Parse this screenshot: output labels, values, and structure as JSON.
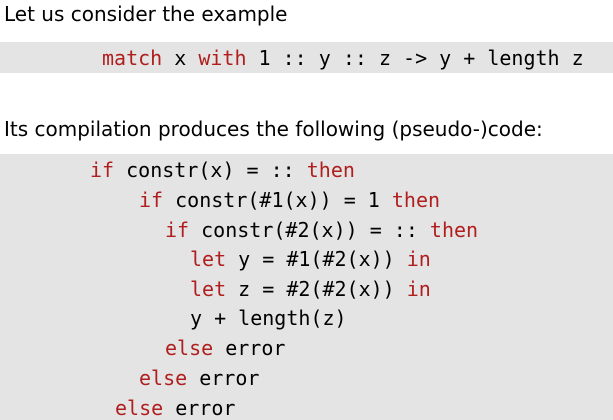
{
  "intro": "Let us consider the example",
  "example_code": {
    "kw_match": "match",
    "seg1": " x ",
    "kw_with": "with",
    "seg2": " 1 :: y :: z -> y + length z"
  },
  "compilation_text": "Its compilation produces the following (pseudo-)code:",
  "compiled_code": {
    "line1": {
      "kw_if": "if",
      "body": " constr(x) = :: ",
      "kw_then": "then"
    },
    "line2": {
      "kw_if": "if",
      "body": " constr(#1(x)) = 1 ",
      "kw_then": "then"
    },
    "line3": {
      "kw_if": "if",
      "body": " constr(#2(x)) = :: ",
      "kw_then": "then"
    },
    "line4": {
      "kw_let": "let",
      "body": " y = #1(#2(x)) ",
      "kw_in": "in"
    },
    "line5": {
      "kw_let": "let",
      "body": " z = #2(#2(x)) ",
      "kw_in": "in"
    },
    "line6": {
      "body": "y + length(z)"
    },
    "line7": {
      "kw_else": "else",
      "body": " error"
    },
    "line8": {
      "kw_else": "else",
      "body": " error"
    },
    "line9": {
      "kw_else": "else",
      "body": " error"
    }
  },
  "colors": {
    "keyword": "#b01e1e",
    "code_background": "#e4e4e4",
    "text": "#000000"
  }
}
